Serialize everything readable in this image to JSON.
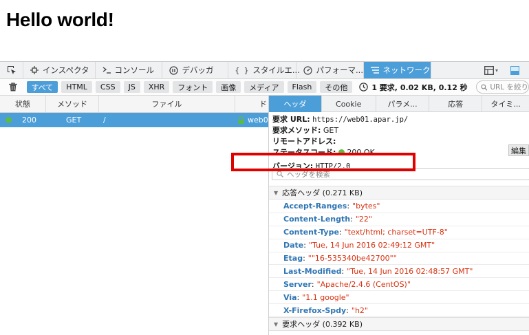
{
  "page": {
    "heading": "Hello world!"
  },
  "toolbox": {
    "tabs": [
      {
        "label": "インスペクタ",
        "icon": "inspector-icon"
      },
      {
        "label": "コンソール",
        "icon": "console-icon"
      },
      {
        "label": "デバッガ",
        "icon": "debugger-icon"
      },
      {
        "label": "スタイルエ...",
        "icon": "style-editor-icon"
      },
      {
        "label": "パフォーマ...",
        "icon": "performance-icon"
      },
      {
        "label": "ネットワーク",
        "icon": "network-icon"
      }
    ],
    "selected": "ネットワーク"
  },
  "network_toolbar": {
    "filters": [
      "すべて",
      "HTML",
      "CSS",
      "JS",
      "XHR",
      "フォント",
      "画像",
      "メディア",
      "Flash",
      "その他"
    ],
    "active_filter": "すべて",
    "summary": "1 要求, 0.02 KB, 0.12 秒",
    "url_filter_placeholder": "URL を絞り"
  },
  "request_table": {
    "columns": [
      "状態",
      "メソッド",
      "ファイル",
      "ド"
    ],
    "rows": [
      {
        "status": "200",
        "method": "GET",
        "file": "/",
        "domain": "web0"
      }
    ]
  },
  "details": {
    "tabs": [
      "ヘッダ",
      "Cookie",
      "パラメ...",
      "応答",
      "タイミ..."
    ],
    "selected_tab": "ヘッダ",
    "summary": {
      "url_label": "要求 URL:",
      "url": "https://web01.apar.jp/",
      "method_label": "要求メソッド:",
      "method": "GET",
      "remote_label": "リモートアドレス:",
      "status_label": "ステータスコード:",
      "status": "200 OK",
      "version_label": "バージョン:",
      "version": "HTTP/2.0"
    },
    "edit_button": "編集",
    "header_search_placeholder": "ヘッダを検索",
    "response_headers_title": "応答ヘッダ (0.271 KB)",
    "response_headers": [
      {
        "name": "Accept-Ranges",
        "value": "\"bytes\""
      },
      {
        "name": "Content-Length",
        "value": "\"22\""
      },
      {
        "name": "Content-Type",
        "value": "\"text/html; charset=UTF-8\""
      },
      {
        "name": "Date",
        "value": "\"Tue, 14 Jun 2016 02:49:12 GMT\""
      },
      {
        "name": "Etag",
        "value": "\"\"16-535340be42700\"\""
      },
      {
        "name": "Last-Modified",
        "value": "\"Tue, 14 Jun 2016 02:48:57 GMT\""
      },
      {
        "name": "Server",
        "value": "\"Apache/2.4.6 (CentOS)\""
      },
      {
        "name": "Via",
        "value": "\"1.1 google\""
      },
      {
        "name": "X-Firefox-Spdy",
        "value": "\"h2\""
      }
    ],
    "request_headers_title": "要求ヘッダ (0.392 KB)"
  },
  "colors": {
    "accent": "#4c9ed9",
    "success": "#5cbb44",
    "header_name": "#2f75b3",
    "header_value": "#d8300f",
    "annotation": "#e00000"
  }
}
